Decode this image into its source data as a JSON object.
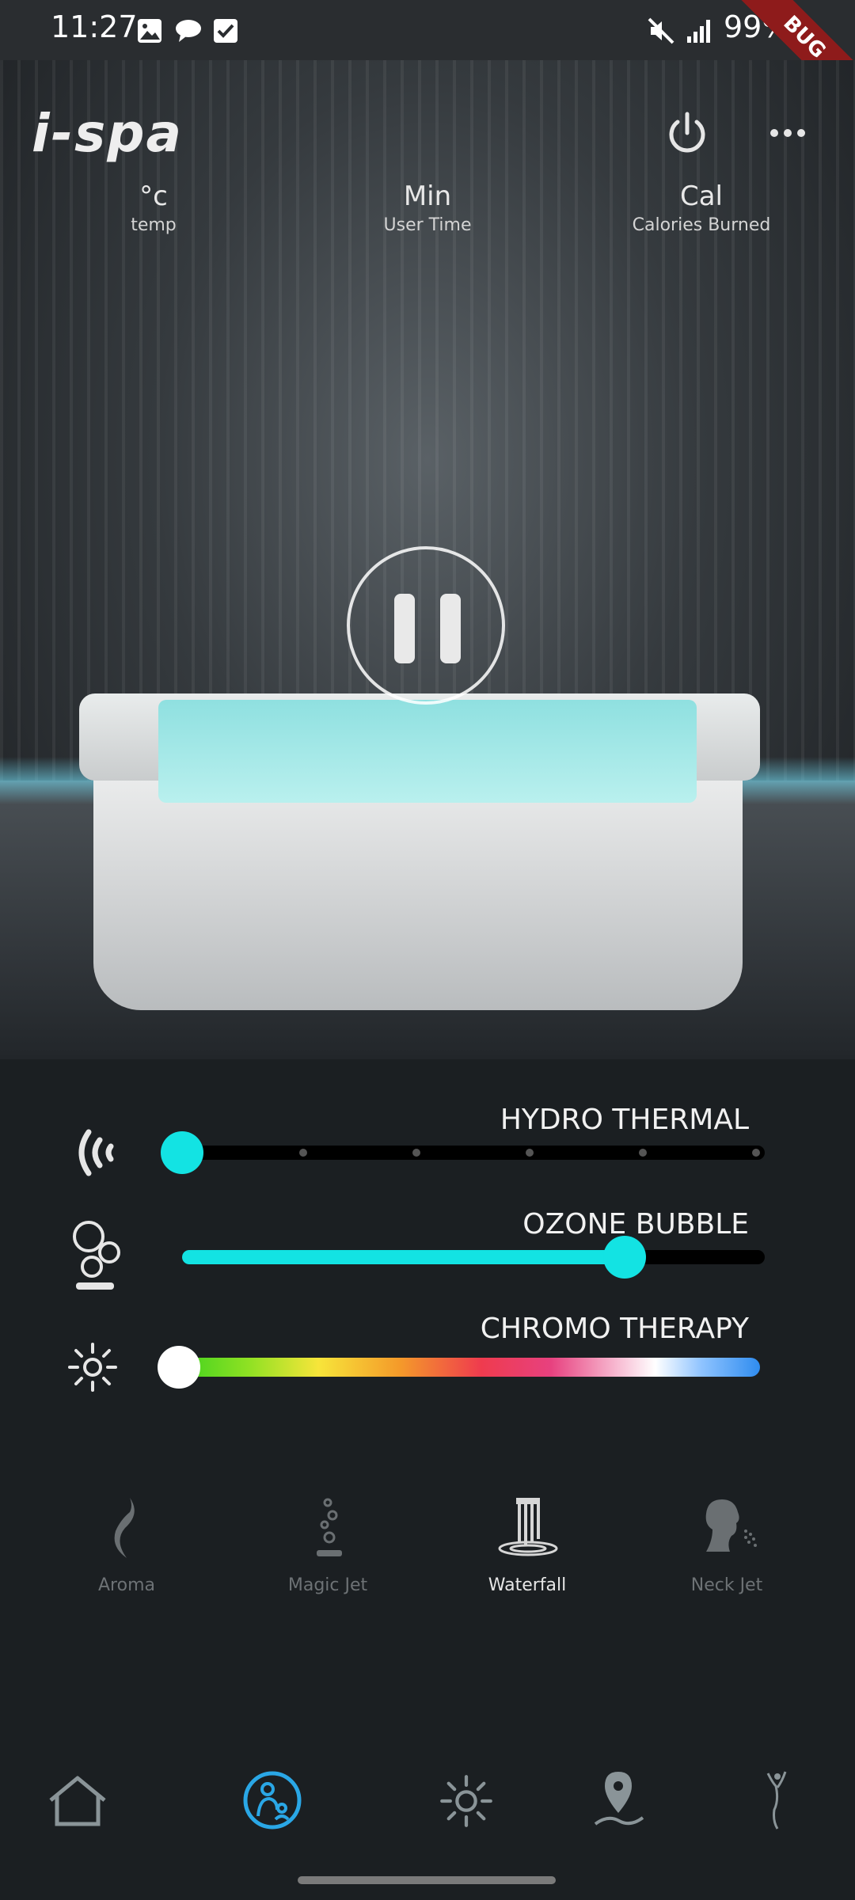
{
  "status_bar": {
    "time": "11:27",
    "battery": "99%",
    "icons": [
      "image-icon",
      "message-icon",
      "checkbox-icon",
      "mute-icon",
      "signal-icon",
      "battery-icon"
    ]
  },
  "debug_banner": "BUG",
  "header": {
    "logo": "i-spa",
    "power_icon": "power-icon",
    "more_icon": "more-icon"
  },
  "stats": [
    {
      "value": "°c",
      "label": "temp"
    },
    {
      "value": "Min",
      "label": "User Time"
    },
    {
      "value": "Cal",
      "label": "Calories Burned"
    }
  ],
  "controls": {
    "hydro_thermal": {
      "label": "HYDRO THERMAL",
      "level": 0.0,
      "steps": 6,
      "color": "#13e3e3"
    },
    "ozone_bubble": {
      "label": "OZONE BUBBLE",
      "level": 0.76,
      "color": "#13e3e3"
    },
    "chromo_therapy": {
      "label": "CHROMO THERAPY",
      "level": 0.0
    }
  },
  "features": [
    {
      "label": "Aroma",
      "icon": "aroma-icon",
      "active": false
    },
    {
      "label": "Magic Jet",
      "icon": "magic-jet-icon",
      "active": false
    },
    {
      "label": "Waterfall",
      "icon": "waterfall-icon",
      "active": true
    },
    {
      "label": "Neck Jet",
      "icon": "neck-jet-icon",
      "active": false
    }
  ],
  "bottom_nav": [
    {
      "icon": "home-icon",
      "active": false
    },
    {
      "icon": "spa-user-icon",
      "active": true
    },
    {
      "icon": "light-icon",
      "active": false
    },
    {
      "icon": "location-icon",
      "active": false
    },
    {
      "icon": "figure-icon",
      "active": false
    }
  ],
  "colors": {
    "accent": "#13e3e3",
    "nav_active": "#2aa7e6",
    "inactive": "#7a7f82"
  }
}
